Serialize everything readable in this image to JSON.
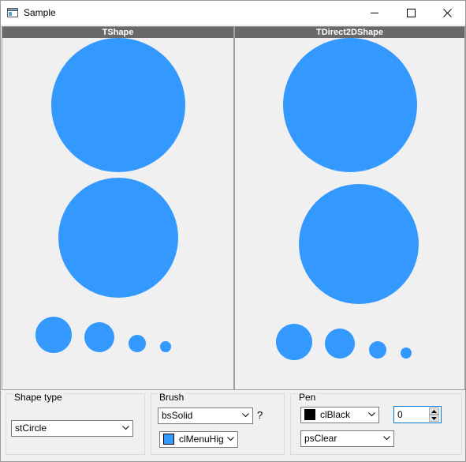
{
  "window": {
    "title": "Sample",
    "controls": [
      "minimize",
      "maximize",
      "close"
    ]
  },
  "panels": {
    "left": {
      "title": "TShape"
    },
    "right": {
      "title": "TDirect2DShape"
    }
  },
  "shape_color": "#3399ff",
  "shape_type": {
    "label": "Shape type",
    "value": "stCircle"
  },
  "brush": {
    "label": "Brush",
    "style": "bsSolid",
    "help": "?",
    "color_name": "clMenuHig",
    "color_swatch": "#3399ff"
  },
  "pen": {
    "label": "Pen",
    "color_name": "clBlack",
    "color_swatch": "#000000",
    "width": "0",
    "style": "psClear"
  }
}
